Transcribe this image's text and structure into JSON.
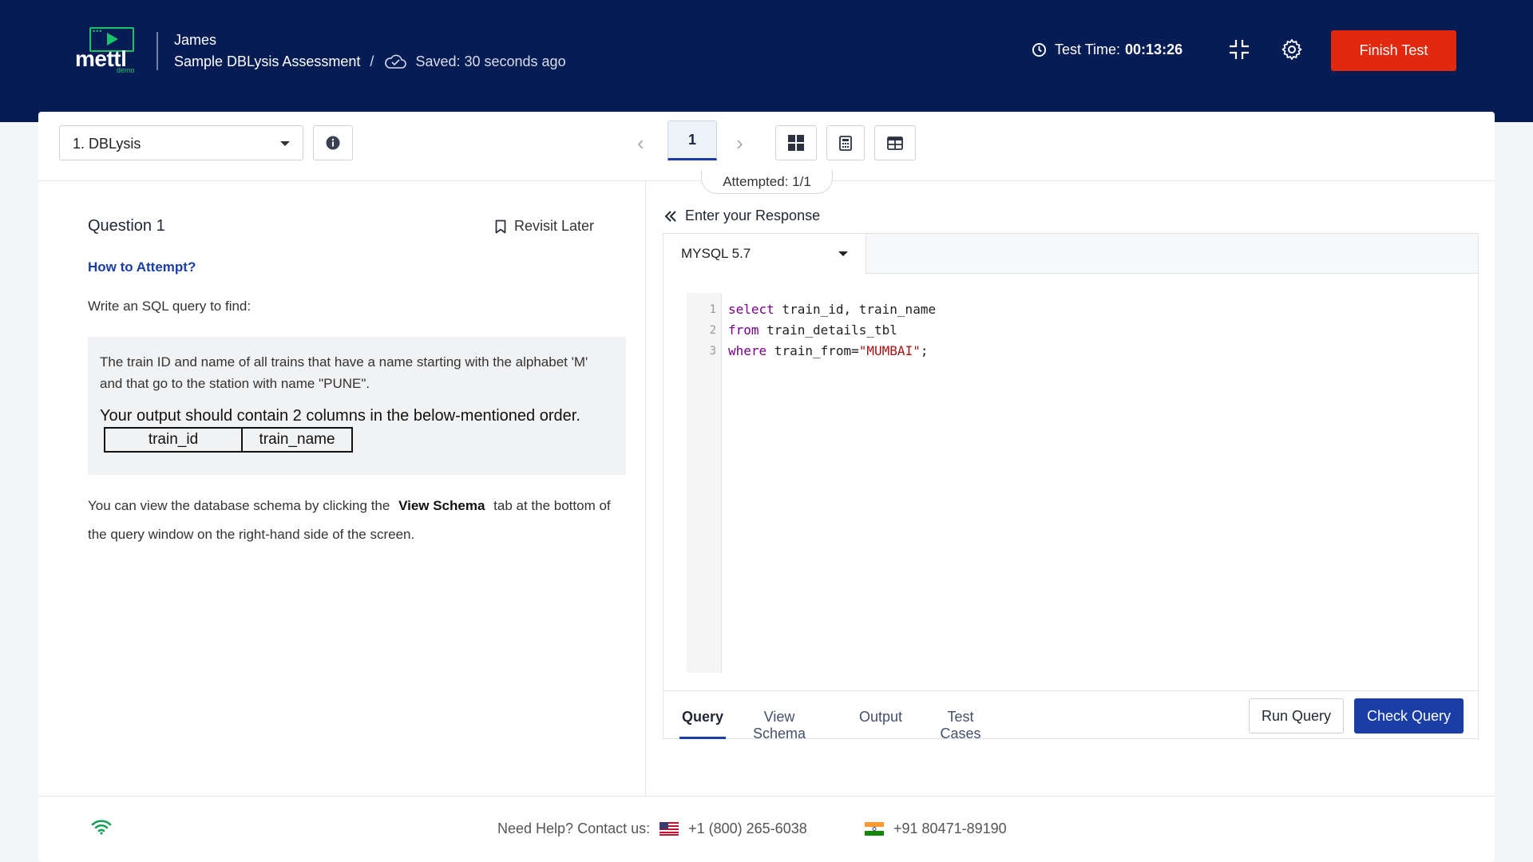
{
  "header": {
    "logo_text": "mettl",
    "logo_sub": "demo",
    "user_name": "James",
    "assessment_title": "Sample DBLysis Assessment",
    "separator": "/",
    "saved_status": "Saved: 30 seconds ago",
    "timer_label": "Test Time:",
    "timer_value": "00:13:26",
    "finish_label": "Finish Test",
    "finish_color": "#e0290f",
    "bg_color": "#051c55"
  },
  "toolbar": {
    "section_selected": "1. DBLysis",
    "current_page": "1",
    "attempted": "Attempted: 1/1",
    "prev_arrow": "‹",
    "next_arrow": "›",
    "icons": [
      "info-icon",
      "grid-view-icon",
      "calculator-icon",
      "table-icon"
    ]
  },
  "question": {
    "title": "Question 1",
    "revisit_label": "Revisit Later",
    "how_to_attempt": "How to Attempt?",
    "intro": "Write an SQL query to find:",
    "body": "The train ID and name of all trains that have a name starting with the alphabet 'M' and that go to the station with name \"PUNE\".",
    "output_note": "Your output should contain 2 columns in the below-mentioned order.",
    "columns": [
      "train_id",
      "train_name"
    ],
    "footer_before": "You can view the database schema by clicking the",
    "footer_bold": "View Schema",
    "footer_after": "tab at the bottom of the query window on the right-hand side of the screen."
  },
  "response": {
    "heading": "Enter your Response",
    "language": "MYSQL 5.7",
    "line_numbers": [
      "1",
      "2",
      "3"
    ],
    "code_lines": [
      {
        "kw": "select",
        "rest": " train_id, train_name"
      },
      {
        "kw": "from",
        "rest": " train_details_tbl"
      },
      {
        "kw": "where",
        "rest": " train_from=",
        "str": "\"MUMBAI\"",
        "tail": ";"
      }
    ],
    "tabs": [
      "Query",
      "View Schema",
      "Output",
      "Test Cases"
    ],
    "active_tab": "Query",
    "run_label": "Run Query",
    "check_label": "Check Query",
    "accent_color": "#1a3ea6"
  },
  "footer": {
    "help_label": "Need Help? Contact us:",
    "phone_us": "+1 (800) 265-6038",
    "phone_in": "+91 80471-89190"
  }
}
